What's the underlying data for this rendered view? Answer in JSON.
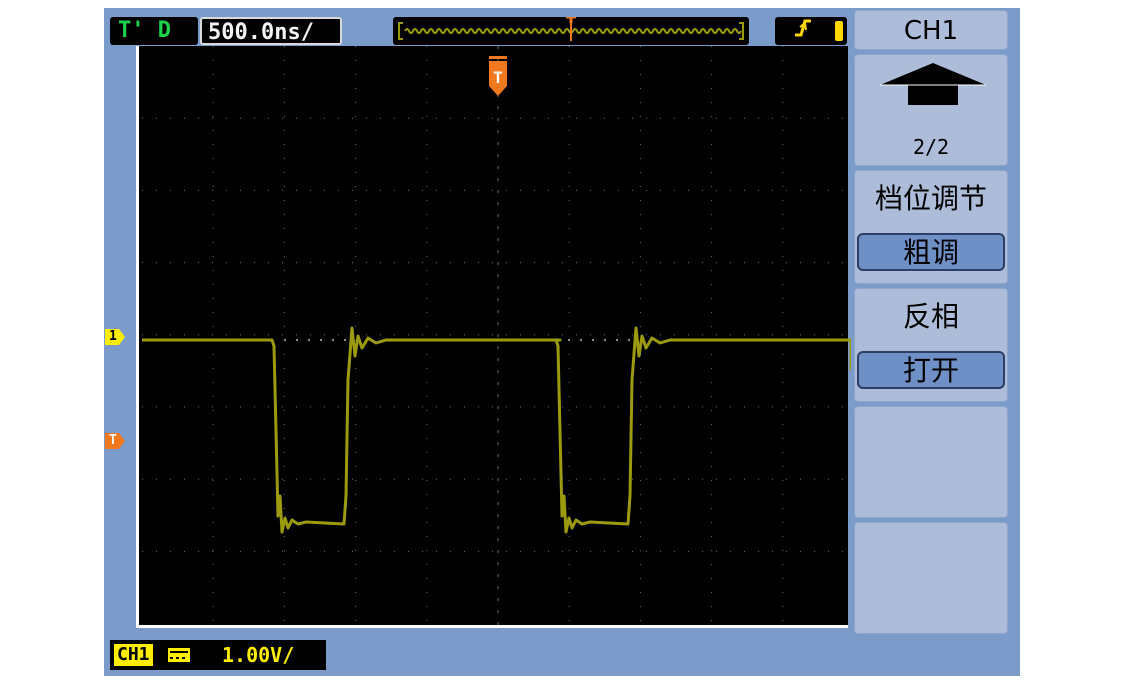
{
  "status_bar": {
    "trigger_status": "T' D",
    "timebase": "500.0ns/",
    "trigger_type_icon": "rising-edge-icon"
  },
  "markers": {
    "channel1": "1",
    "trigger": "T",
    "trigger_position": "T"
  },
  "readout": {
    "channel_tag": "CH1",
    "coupling_icon": "dc-coupling-icon",
    "vertical_scale": "1.00V/"
  },
  "menu": {
    "title": "CH1",
    "page_icon": "page-up-arrow-icon",
    "page": "2/2",
    "volts_div_label": "档位调节",
    "volts_div_value": "粗调",
    "invert_label": "反相",
    "invert_value": "打开"
  },
  "colors": {
    "channel1": "#ffee00",
    "trace": "#9c9a0e",
    "trigger": "#f0781e",
    "screen_bg": "#000000",
    "frame": "#7b9bcb",
    "menu_box": "#adbdd9",
    "menu_value": "#6f8fc7"
  }
}
